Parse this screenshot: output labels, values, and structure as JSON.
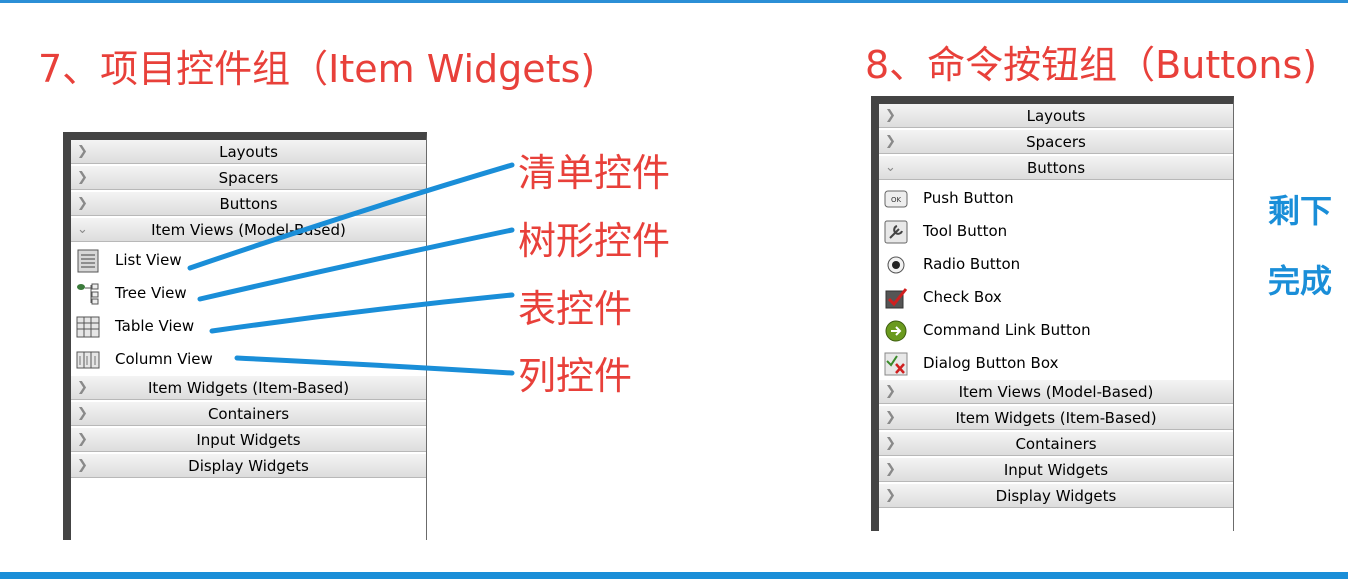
{
  "left": {
    "heading": "7、项目控件组（Item Widgets)",
    "categories_top": [
      "Layouts",
      "Spacers",
      "Buttons"
    ],
    "expanded_category": "Item Views (Model-Based)",
    "items": [
      {
        "label": "List View",
        "icon": "list-view-icon"
      },
      {
        "label": "Tree View",
        "icon": "tree-view-icon"
      },
      {
        "label": "Table View",
        "icon": "table-view-icon"
      },
      {
        "label": "Column View",
        "icon": "column-view-icon"
      }
    ],
    "categories_bottom": [
      "Item Widgets (Item-Based)",
      "Containers",
      "Input Widgets",
      "Display Widgets"
    ],
    "annotations": [
      "清单控件",
      "树形控件",
      "表控件",
      "列控件"
    ]
  },
  "right": {
    "heading": "8、命令按钮组（Buttons)",
    "categories_top": [
      "Layouts",
      "Spacers"
    ],
    "expanded_category": "Buttons",
    "items": [
      {
        "label": "Push Button",
        "icon": "push-button-icon"
      },
      {
        "label": "Tool Button",
        "icon": "tool-button-icon"
      },
      {
        "label": "Radio Button",
        "icon": "radio-button-icon"
      },
      {
        "label": "Check Box",
        "icon": "check-box-icon"
      },
      {
        "label": "Command Link Button",
        "icon": "command-link-icon"
      },
      {
        "label": "Dialog Button Box",
        "icon": "dialog-button-box-icon"
      }
    ],
    "categories_bottom": [
      "Item Views (Model-Based)",
      "Item Widgets (Item-Based)",
      "Containers",
      "Input Widgets",
      "Display Widgets"
    ],
    "side_notes": [
      "剩下",
      "完成"
    ]
  },
  "colors": {
    "heading": "#e8403a",
    "accent_blue": "#1a8ed8"
  }
}
